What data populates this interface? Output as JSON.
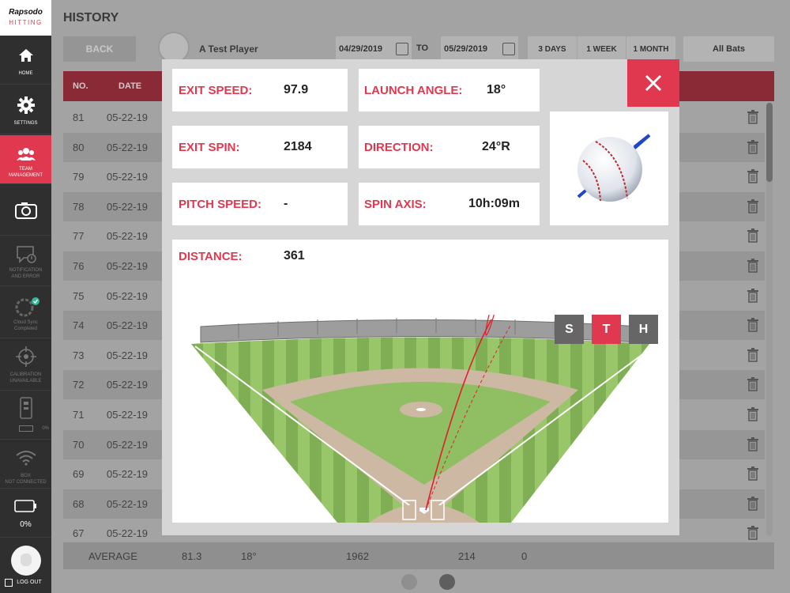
{
  "app": {
    "brand_name": "Rapsodo",
    "brand_product": "HITTING"
  },
  "page": {
    "title": "HISTORY"
  },
  "sidebar": {
    "items": [
      {
        "label": "HOME"
      },
      {
        "label": "SETTINGS"
      },
      {
        "label": "TEAM\nMANAGEMENT"
      },
      {
        "label": ""
      },
      {
        "label": "NOTIFICATION\nAND ERROR"
      },
      {
        "label": "Cloud Sync\nCompleted"
      },
      {
        "label": "CALIBRATION\nUNAVAILABLE"
      },
      {
        "label": "0%"
      },
      {
        "label": "BOX\nNOT CONNECTED"
      }
    ],
    "battery_percent": "0%",
    "logout_label": "LOG OUT"
  },
  "header": {
    "back_label": "BACK",
    "player_name": "A Test Player",
    "date_from": "04/29/2019",
    "to_label": "TO",
    "date_to": "05/29/2019",
    "ranges": [
      "3 DAYS",
      "1 WEEK",
      "1 MONTH"
    ],
    "bat_filter": "All Bats"
  },
  "table": {
    "columns": {
      "no": "NO.",
      "date": "DATE"
    },
    "rows": [
      {
        "no": "81",
        "date": "05-22-19"
      },
      {
        "no": "80",
        "date": "05-22-19"
      },
      {
        "no": "79",
        "date": "05-22-19"
      },
      {
        "no": "78",
        "date": "05-22-19"
      },
      {
        "no": "77",
        "date": "05-22-19"
      },
      {
        "no": "76",
        "date": "05-22-19"
      },
      {
        "no": "75",
        "date": "05-22-19"
      },
      {
        "no": "74",
        "date": "05-22-19"
      },
      {
        "no": "73",
        "date": "05-22-19"
      },
      {
        "no": "72",
        "date": "05-22-19"
      },
      {
        "no": "71",
        "date": "05-22-19"
      },
      {
        "no": "70",
        "date": "05-22-19"
      },
      {
        "no": "69",
        "date": "05-22-19"
      },
      {
        "no": "68",
        "date": "05-22-19"
      },
      {
        "no": "67",
        "date": "05-22-19"
      }
    ]
  },
  "average": {
    "label": "AVERAGE",
    "exit_speed": "81.3",
    "launch_angle": "18°",
    "exit_spin": "1962",
    "distance": "214",
    "zero": "0"
  },
  "modal": {
    "exit_speed": {
      "label": "EXIT SPEED:",
      "value": "97.9"
    },
    "launch_angle": {
      "label": "LAUNCH ANGLE:",
      "value": "18°"
    },
    "exit_spin": {
      "label": "EXIT SPIN:",
      "value": "2184"
    },
    "direction": {
      "label": "DIRECTION:",
      "value": "24°R"
    },
    "pitch_speed": {
      "label": "PITCH SPEED:",
      "value": "-"
    },
    "spin_axis": {
      "label": "SPIN AXIS:",
      "value": "10h:09m"
    },
    "distance": {
      "label": "DISTANCE:",
      "value": "361"
    },
    "view_buttons": [
      "S",
      "T",
      "H"
    ],
    "active_view": "T",
    "colors": {
      "accent": "#e0384e",
      "inactive_button": "#666666"
    }
  }
}
